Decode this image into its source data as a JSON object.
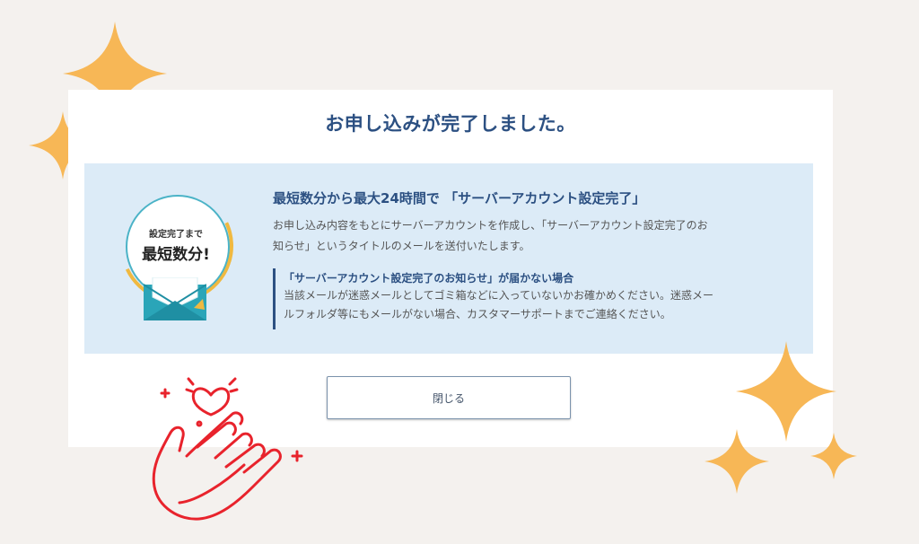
{
  "dialog": {
    "title": "お申し込みが完了しました。",
    "badge": {
      "small_text": "設定完了まで",
      "big_text": "最短数分!"
    },
    "heading": "最短数分から最大24時間で 「サーバーアカウント設定完了」",
    "body_lines": [
      "お申し込み内容をもとにサーバーアカウントを作成し、「サーバーアカウント設定完了のお",
      "知らせ」というタイトルのメールを送付いたします。"
    ],
    "notice": {
      "title": "「サーバーアカウント設定完了のお知らせ」が届かない場合",
      "lines": [
        "当該メールが迷惑メールとしてゴミ箱などに入っていないかお確かめください。迷惑メー",
        "ルフォルダ等にもメールがない場合、カスタマーサポートまでご連絡ください。"
      ]
    },
    "close_label": "閉じる"
  },
  "decorations": {
    "sparkle_color": "#f7b756",
    "clap_color": "#e8232c",
    "icons": [
      "sparkle-icon",
      "clapping-hands-heart-icon",
      "envelope-icon"
    ]
  },
  "colors": {
    "title": "#2c5082",
    "info_background": "#dcebf7",
    "page_background": "#f4f1ee"
  }
}
